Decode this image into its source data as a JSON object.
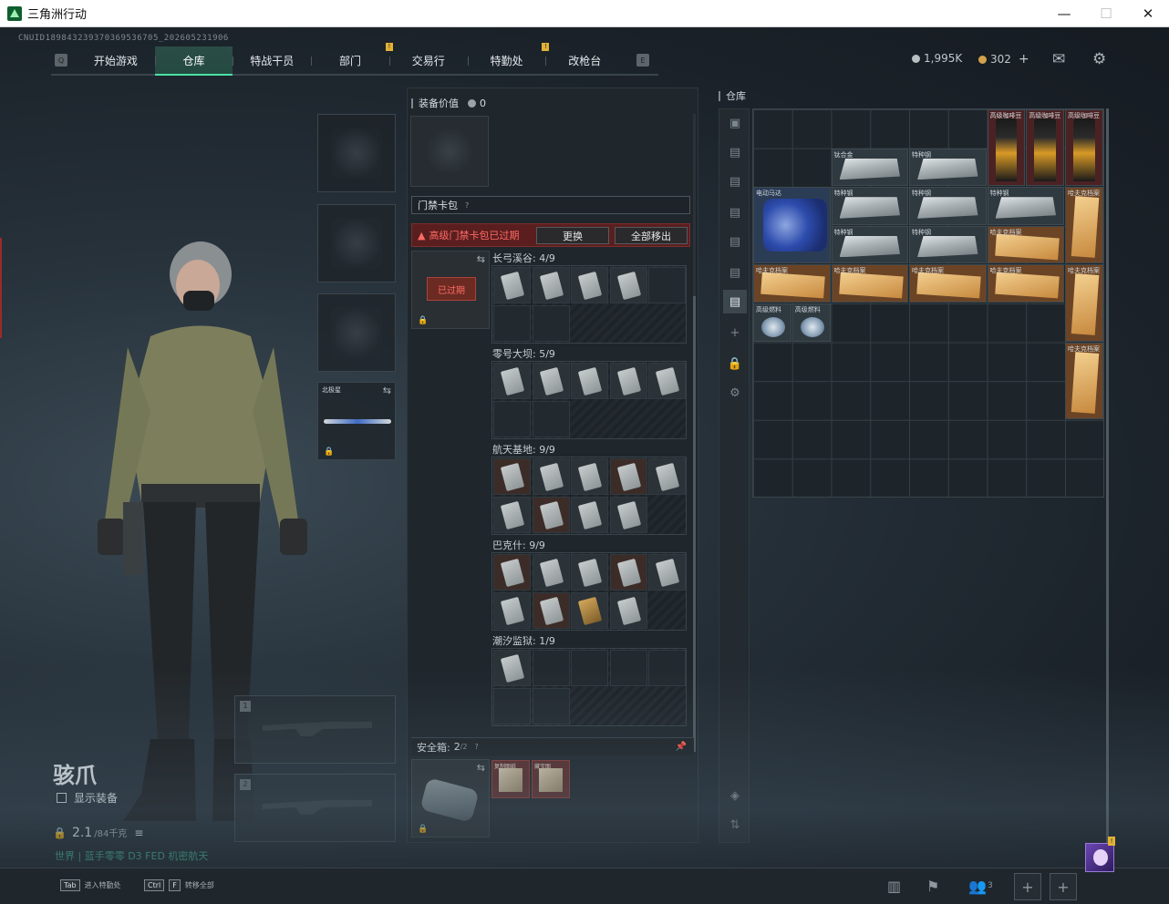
{
  "window": {
    "title": "三角洲行动",
    "minimize": "—",
    "maximize": "☐",
    "close": "✕"
  },
  "uid": "CNUID189843239370369536705_202605231906",
  "nav": {
    "tabs": [
      {
        "label": "开始游戏",
        "alert": false
      },
      {
        "label": "仓库",
        "alert": false,
        "active": true
      },
      {
        "label": "特战干员",
        "alert": false
      },
      {
        "label": "部门",
        "alert": true
      },
      {
        "label": "交易行",
        "alert": false
      },
      {
        "label": "特勤处",
        "alert": true
      },
      {
        "label": "改枪台",
        "alert": false
      }
    ],
    "left_key": "Q",
    "right_key": "E",
    "alert_glyph": "!"
  },
  "currency": {
    "silver": "1,995K",
    "coin": "302",
    "add": "+"
  },
  "icons": {
    "mail": "mail-icon",
    "settings": "gear-icon"
  },
  "character": {
    "name": "骇爪",
    "show_equipment": "显示装备",
    "weight_value": "2.1",
    "weight_unit": "/84千克",
    "status": "世界 | 蓝手零零 D3 FED 机密航天"
  },
  "equip_slots": {
    "melee_label": "北极星",
    "weapon_1": "1",
    "weapon_2": "2"
  },
  "backpack": {
    "header": "装备价值",
    "value": "0",
    "keybag_title": "门禁卡包",
    "help": "?",
    "warning": "高级门禁卡包已过期",
    "replace_button": "更换",
    "remove_all_button": "全部移出",
    "expired_tag": "已过期",
    "maps": [
      {
        "name": "长弓溪谷: 4/9"
      },
      {
        "name": "零号大坝: 5/9"
      },
      {
        "name": "航天基地: 9/9"
      },
      {
        "name": "巴克什: 9/9"
      },
      {
        "name": "潮汐监狱: 1/9"
      }
    ],
    "safebox_title": "安全箱:",
    "safebox_count": "2",
    "safebox_cap": "/2",
    "safe_items": [
      "复制图纸",
      "藏宝图"
    ]
  },
  "warehouse": {
    "title": "仓库",
    "items": {
      "coffee": "高级咖啡豆",
      "alloy": "钛合金",
      "steel": "特种钢",
      "motor": "电动马达",
      "folder": "哈夫克档案",
      "fuel": "高级燃料"
    }
  },
  "bottom": {
    "hint1_key": "Tab",
    "hint1": "进入特勤处",
    "hint2_key1": "Ctrl",
    "hint2_key2": "F",
    "hint2": "转移全部",
    "team_count": "3",
    "avatar_badge": "!"
  }
}
